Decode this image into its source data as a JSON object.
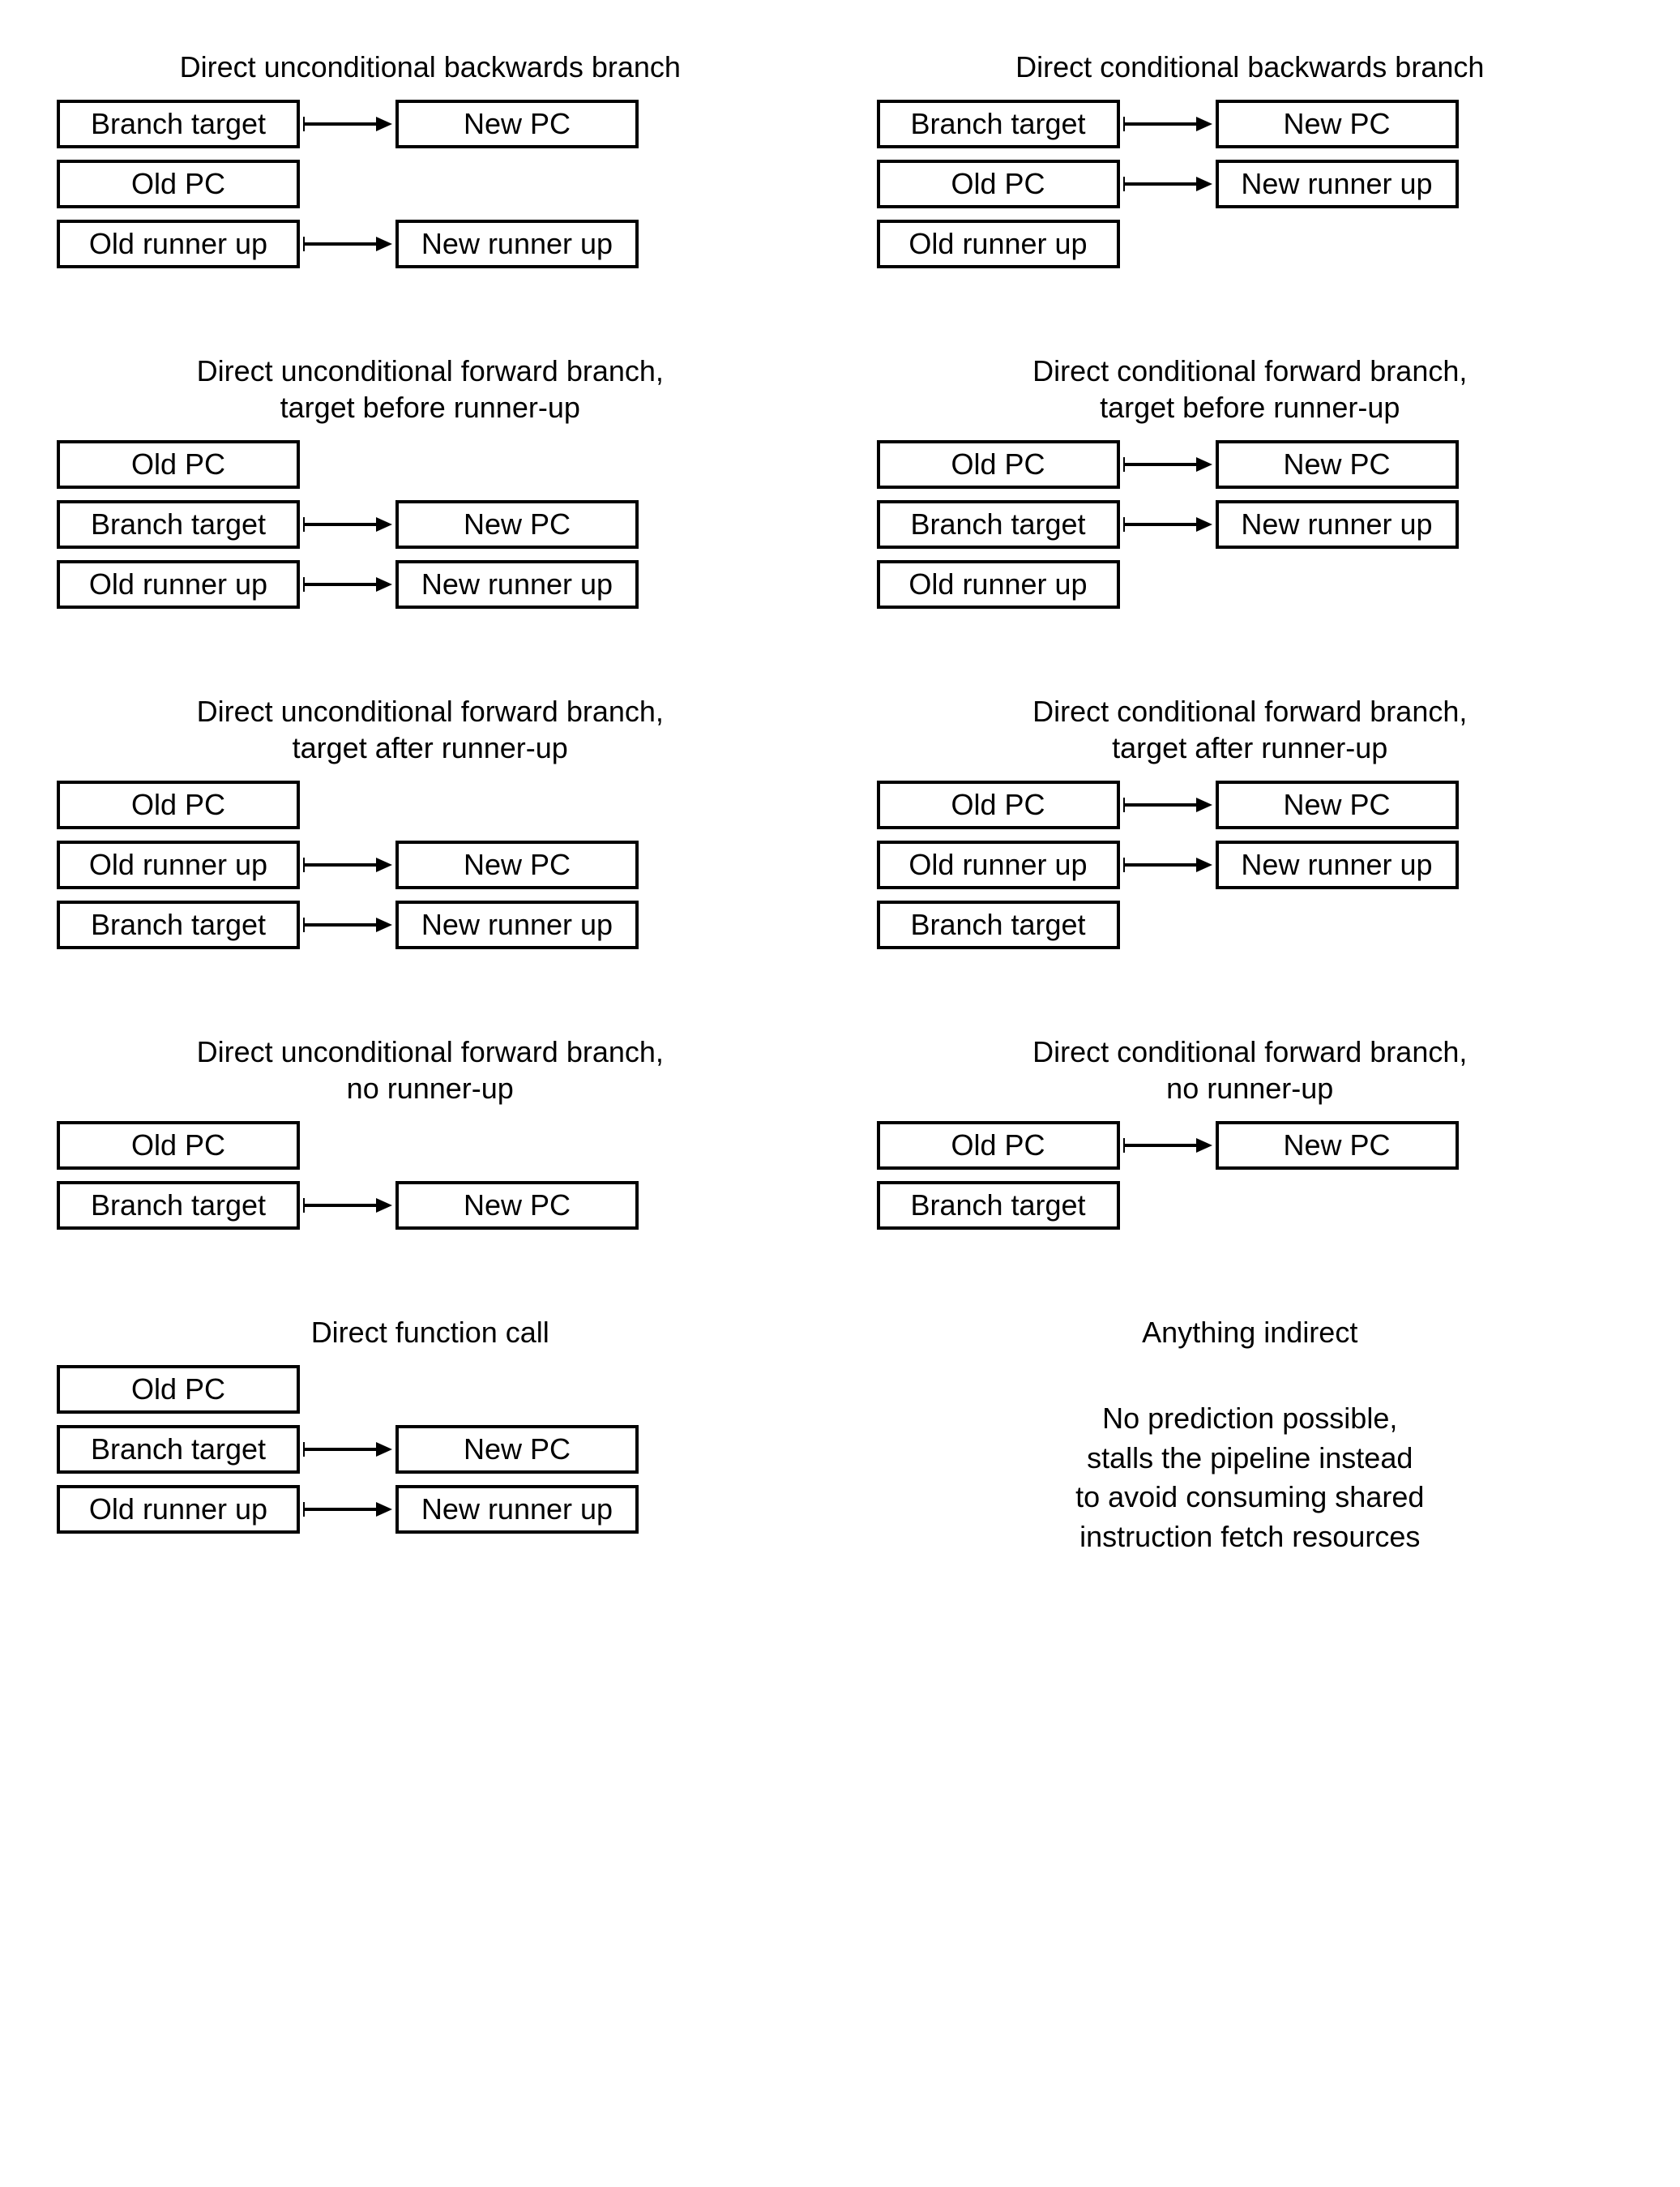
{
  "labels": {
    "branch_target": "Branch target",
    "new_pc": "New PC",
    "old_pc": "Old PC",
    "old_runner_up": "Old runner up",
    "new_runner_up": "New runner up"
  },
  "cells": [
    {
      "title": [
        "Direct unconditional backwards branch"
      ],
      "rows": [
        {
          "left": "branch_target",
          "arrow": true,
          "right": "new_pc"
        },
        {
          "left": "old_pc",
          "arrow": false,
          "right": null
        },
        {
          "left": "old_runner_up",
          "arrow": true,
          "right": "new_runner_up"
        }
      ]
    },
    {
      "title": [
        "Direct conditional backwards branch"
      ],
      "rows": [
        {
          "left": "branch_target",
          "arrow": true,
          "right": "new_pc"
        },
        {
          "left": "old_pc",
          "arrow": true,
          "right": "new_runner_up"
        },
        {
          "left": "old_runner_up",
          "arrow": false,
          "right": null
        }
      ]
    },
    {
      "title": [
        "Direct unconditional forward branch,",
        "target before runner-up"
      ],
      "rows": [
        {
          "left": "old_pc",
          "arrow": false,
          "right": null
        },
        {
          "left": "branch_target",
          "arrow": true,
          "right": "new_pc"
        },
        {
          "left": "old_runner_up",
          "arrow": true,
          "right": "new_runner_up"
        }
      ]
    },
    {
      "title": [
        "Direct conditional forward branch,",
        "target before runner-up"
      ],
      "rows": [
        {
          "left": "old_pc",
          "arrow": true,
          "right": "new_pc"
        },
        {
          "left": "branch_target",
          "arrow": true,
          "right": "new_runner_up"
        },
        {
          "left": "old_runner_up",
          "arrow": false,
          "right": null
        }
      ]
    },
    {
      "title": [
        "Direct unconditional forward branch,",
        "target after runner-up"
      ],
      "rows": [
        {
          "left": "old_pc",
          "arrow": false,
          "right": null
        },
        {
          "left": "old_runner_up",
          "arrow": true,
          "right": "new_pc"
        },
        {
          "left": "branch_target",
          "arrow": true,
          "right": "new_runner_up"
        }
      ]
    },
    {
      "title": [
        "Direct conditional forward branch,",
        "target after runner-up"
      ],
      "rows": [
        {
          "left": "old_pc",
          "arrow": true,
          "right": "new_pc"
        },
        {
          "left": "old_runner_up",
          "arrow": true,
          "right": "new_runner_up"
        },
        {
          "left": "branch_target",
          "arrow": false,
          "right": null
        }
      ]
    },
    {
      "title": [
        "Direct unconditional forward branch,",
        "no runner-up"
      ],
      "rows": [
        {
          "left": "old_pc",
          "arrow": false,
          "right": null
        },
        {
          "left": "branch_target",
          "arrow": true,
          "right": "new_pc"
        }
      ]
    },
    {
      "title": [
        "Direct conditional forward branch,",
        "no runner-up"
      ],
      "rows": [
        {
          "left": "old_pc",
          "arrow": true,
          "right": "new_pc"
        },
        {
          "left": "branch_target",
          "arrow": false,
          "right": null
        }
      ]
    },
    {
      "title": [
        "Direct function call"
      ],
      "rows": [
        {
          "left": "old_pc",
          "arrow": false,
          "right": null
        },
        {
          "left": "branch_target",
          "arrow": true,
          "right": "new_pc"
        },
        {
          "left": "old_runner_up",
          "arrow": true,
          "right": "new_runner_up"
        }
      ]
    },
    {
      "title": [
        "Anything indirect"
      ],
      "note": [
        "No prediction possible,",
        "stalls the pipeline instead",
        "to avoid consuming shared",
        "instruction fetch resources"
      ]
    }
  ]
}
